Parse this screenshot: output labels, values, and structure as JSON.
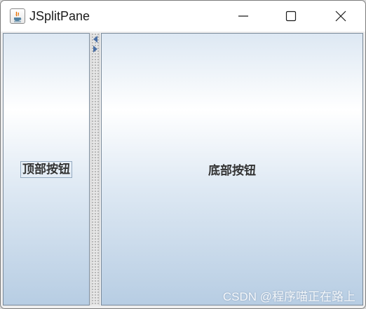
{
  "window": {
    "title": "JSplitPane",
    "app_icon": "java-icon",
    "controls": {
      "minimize_icon": "minimize-icon",
      "maximize_icon": "maximize-icon",
      "close_icon": "close-icon"
    }
  },
  "split_pane": {
    "left_button_label": "顶部按钮",
    "right_button_label": "底部按钮",
    "divider_arrows": [
      "collapse-left-arrow-icon",
      "expand-right-arrow-icon"
    ]
  },
  "watermark": "CSDN @程序喵正在路上",
  "colors": {
    "button_gradient_top": "#dde8f3",
    "button_gradient_mid": "#ffffff",
    "button_gradient_bottom": "#b7cde3",
    "arrow": "#4a6fa5"
  }
}
